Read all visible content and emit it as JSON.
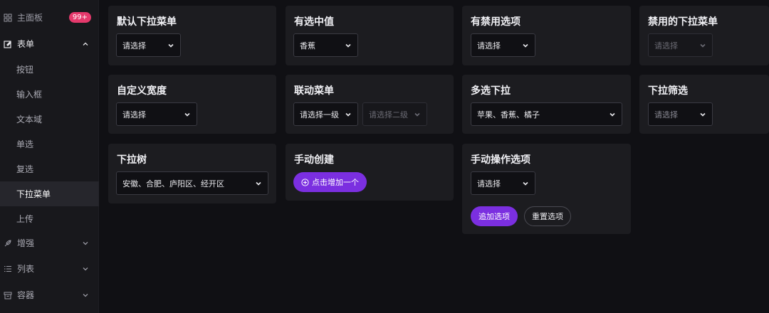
{
  "sidebar": {
    "dashboard": {
      "label": "主面板",
      "badge": "99+",
      "icon": "grid-icon"
    },
    "form": {
      "label": "表单",
      "icon": "form-icon"
    },
    "sub_items": [
      "按钮",
      "输入框",
      "文本域",
      "单选",
      "复选",
      "下拉菜单",
      "上传"
    ],
    "active_item": "下拉菜单",
    "enhance": {
      "label": "增强",
      "icon": "feather-icon"
    },
    "list": {
      "label": "列表",
      "icon": "list-icon"
    },
    "container": {
      "label": "容器",
      "icon": "archive-icon"
    }
  },
  "cards": {
    "default_select": {
      "title": "默认下拉菜单",
      "value": "请选择"
    },
    "selected_value": {
      "title": "有选中值",
      "value": "香蕉"
    },
    "disabled_option": {
      "title": "有禁用选项",
      "value": "请选择"
    },
    "disabled_select": {
      "title": "禁用的下拉菜单",
      "value": "请选择"
    },
    "custom_width": {
      "title": "自定义宽度",
      "value": "请选择"
    },
    "cascade": {
      "title": "联动菜单",
      "level1": "请选择一级",
      "level2": "请选择二级"
    },
    "multi_select": {
      "title": "多选下拉",
      "value": "苹果、香蕉、橘子"
    },
    "filter_select": {
      "title": "下拉筛选",
      "value": "请选择"
    },
    "tree_select": {
      "title": "下拉树",
      "value": "安徽、合肥、庐阳区、经开区"
    },
    "manual_create": {
      "title": "手动创建",
      "button": "点击增加一个"
    },
    "manual_ops": {
      "title": "手动操作选项",
      "value": "请选择",
      "add_button": "追加选项",
      "reset_button": "重置选项"
    }
  },
  "colors": {
    "accent": "#7b2fe0",
    "badge": "#e5396c",
    "card": "#1c1c20",
    "background": "#101014"
  }
}
